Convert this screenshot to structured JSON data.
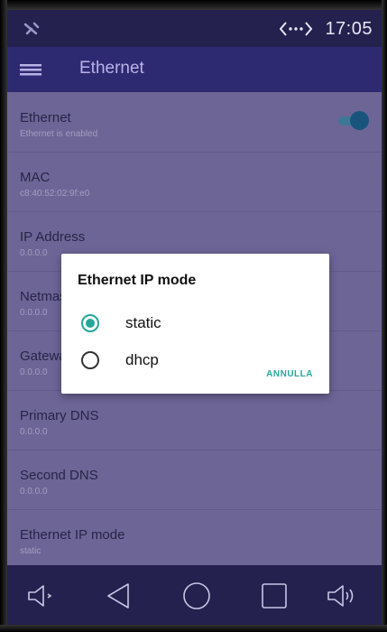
{
  "status_bar": {
    "time": "17:05",
    "left_icon": "signal-off-icon",
    "network_icon": "ethernet-icon"
  },
  "toolbar": {
    "title": "Ethernet",
    "menu_icon": "hamburger-menu-icon"
  },
  "settings": {
    "items": [
      {
        "label": "Ethernet",
        "summary": "Ethernet is enabled",
        "toggle": true
      },
      {
        "label": "MAC",
        "summary": "c8:40:52:02:9f:e0"
      },
      {
        "label": "IP Address",
        "summary": "0.0.0.0"
      },
      {
        "label": "Netmask",
        "summary": "0.0.0.0"
      },
      {
        "label": "Gateway",
        "summary": "0.0.0.0"
      },
      {
        "label": "Primary DNS",
        "summary": "0.0.0.0"
      },
      {
        "label": "Second DNS",
        "summary": "0.0.0.0"
      },
      {
        "label": "Ethernet IP mode",
        "summary": "static"
      }
    ]
  },
  "dialog": {
    "title": "Ethernet IP mode",
    "options": [
      {
        "label": "static",
        "selected": true
      },
      {
        "label": "dhcp",
        "selected": false
      }
    ],
    "cancel_label": "ANNULLA"
  },
  "nav_bar": {
    "icons": [
      "volume-down-icon",
      "back-icon",
      "home-icon",
      "recents-icon",
      "volume-up-icon"
    ]
  },
  "colors": {
    "accent": "#26a69a",
    "toolbar": "#2e2a72",
    "status_bar": "#24214f",
    "content_bg": "#7e76a8"
  }
}
